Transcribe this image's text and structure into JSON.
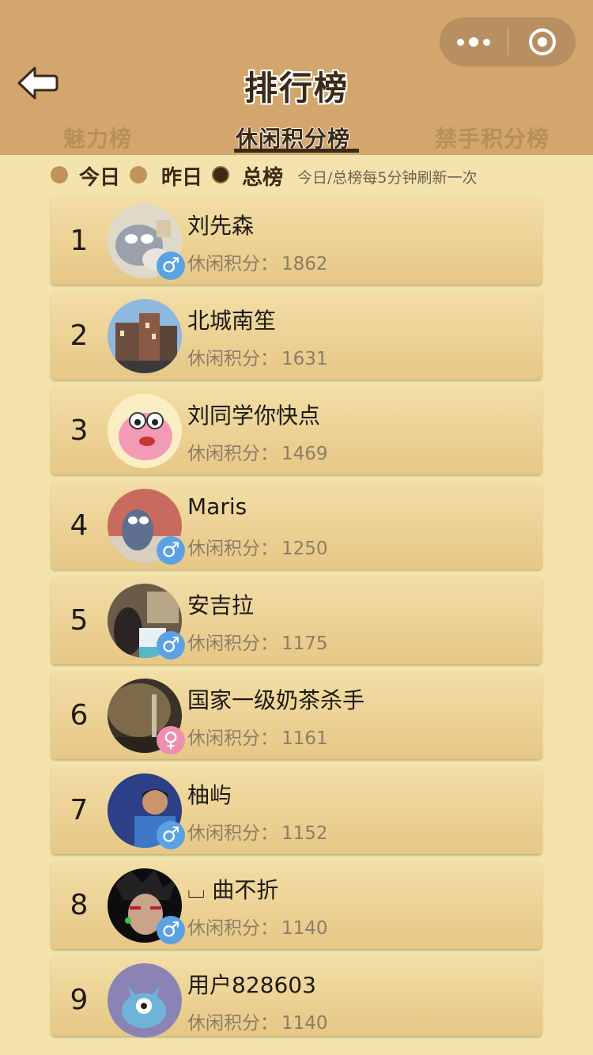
{
  "header": {
    "title": "排行榜",
    "capsule": {
      "more_icon": "more-dots-icon",
      "close_icon": "target-circle-icon"
    },
    "back_icon": "back-arrow-icon"
  },
  "tabs": [
    {
      "label": "魅力榜",
      "active": false
    },
    {
      "label": "休闲积分榜",
      "active": true
    },
    {
      "label": "禁手积分榜",
      "active": false
    }
  ],
  "filters": {
    "options": [
      {
        "label": "今日",
        "active": false
      },
      {
        "label": "昨日",
        "active": false
      },
      {
        "label": "总榜",
        "active": true
      }
    ],
    "note": "今日/总榜每5分钟刷新一次"
  },
  "score_label": "休闲积分：",
  "colors": {
    "header_bg": "#d3a66e",
    "page_bg": "#f3e4ae",
    "male": "#5aa2e3",
    "female": "#ef8fb0"
  },
  "rows": [
    {
      "rank": "1",
      "name": "刘先森",
      "score": "1862",
      "gender": "male"
    },
    {
      "rank": "2",
      "name": "北城南笙",
      "score": "1631",
      "gender": ""
    },
    {
      "rank": "3",
      "name": "刘同学你快点",
      "score": "1469",
      "gender": ""
    },
    {
      "rank": "4",
      "name": "Maris",
      "score": "1250",
      "gender": "male"
    },
    {
      "rank": "5",
      "name": "安吉拉",
      "score": "1175",
      "gender": "male"
    },
    {
      "rank": "6",
      "name": "国家一级奶茶杀手",
      "score": "1161",
      "gender": "female"
    },
    {
      "rank": "7",
      "name": "柚屿",
      "score": "1152",
      "gender": "male"
    },
    {
      "rank": "8",
      "name": "⌴ 曲不折",
      "score": "1140",
      "gender": "male"
    },
    {
      "rank": "9",
      "name": "用户828603",
      "score": "1140",
      "gender": ""
    }
  ]
}
